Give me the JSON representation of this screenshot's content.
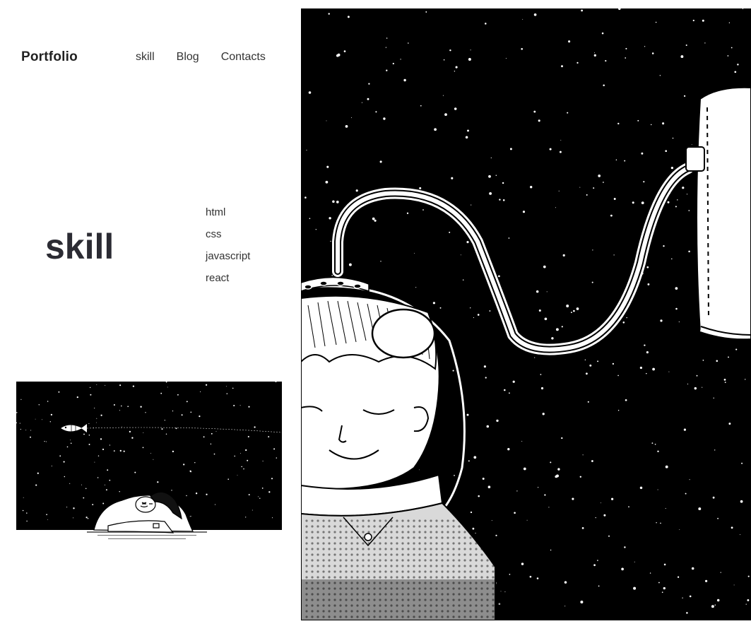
{
  "header": {
    "logo": "Portfolio",
    "nav": [
      "skill",
      "Blog",
      "Contacts"
    ]
  },
  "main": {
    "title": "skill",
    "skills": [
      "html",
      "css",
      "javascript",
      "react"
    ]
  },
  "images": {
    "small": "sleeping-dreamer-fish-illustration",
    "large": "astronaut-book-space-illustration"
  },
  "colors": {
    "ink": "#000000",
    "paper": "#ffffff",
    "title": "#2b2b33"
  }
}
